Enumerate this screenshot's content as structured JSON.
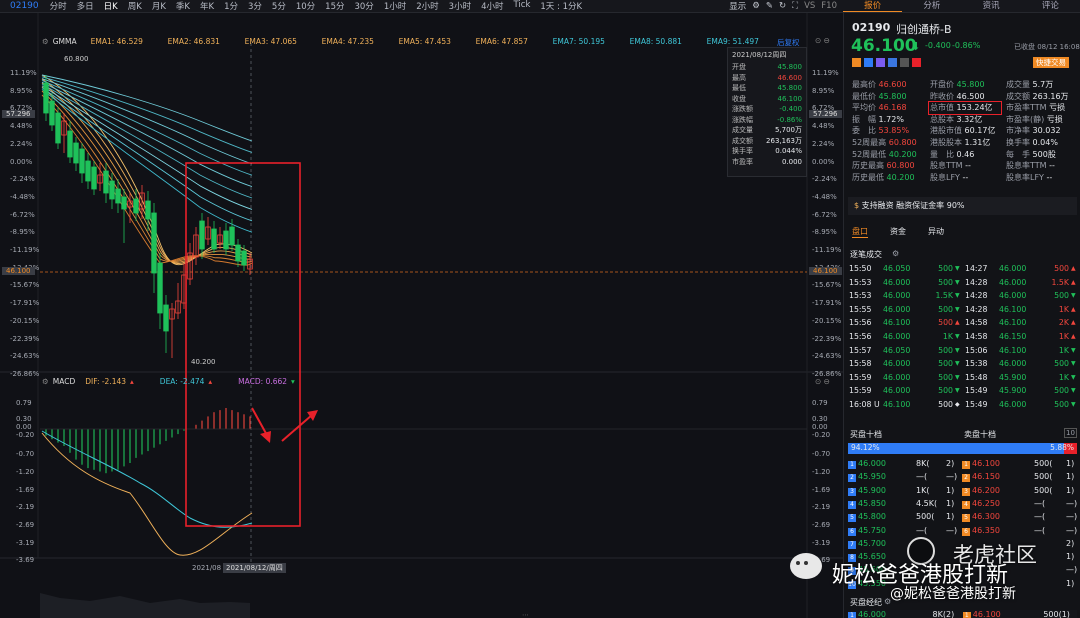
{
  "toolbar": {
    "code": "02190",
    "timeframes": [
      "分时",
      "多日",
      "日K",
      "周K",
      "月K",
      "季K",
      "年K",
      "1分",
      "3分",
      "5分",
      "10分",
      "15分",
      "30分",
      "1小时",
      "2小时",
      "3小时",
      "4小时",
      "Tick"
    ],
    "active_timeframe": "日K",
    "period_select": "1天 : 1分K",
    "display_label": "显示"
  },
  "right_tabs": [
    "报价",
    "分析",
    "资讯",
    "评论"
  ],
  "main_indicator": {
    "name": "GMMA",
    "emas": [
      {
        "label": "EMA1: 46.529",
        "color": "#f0b15a"
      },
      {
        "label": "EMA2: 46.831",
        "color": "#f0b15a"
      },
      {
        "label": "EMA3: 47.065",
        "color": "#f0b15a"
      },
      {
        "label": "EMA4: 47.235",
        "color": "#f0b15a"
      },
      {
        "label": "EMA5: 47.453",
        "color": "#f0b15a"
      },
      {
        "label": "EMA6: 47.857",
        "color": "#f0b15a"
      },
      {
        "label": "EMA7: 50.195",
        "color": "#3fc7d8"
      },
      {
        "label": "EMA8: 50.881",
        "color": "#3fc7d8"
      },
      {
        "label": "EMA9: 51.497",
        "color": "#3fc7d8"
      }
    ],
    "adjust_label": "后复权"
  },
  "y_axis_pct": [
    "11.19%",
    "8.95%",
    "6.72%",
    "4.48%",
    "2.24%",
    "0.00%",
    "-2.24%",
    "-4.48%",
    "-6.72%",
    "-8.95%",
    "-11.19%",
    "-13.43%",
    "-15.67%",
    "-17.91%",
    "-20.15%",
    "-22.39%",
    "-24.63%",
    "-26.86%"
  ],
  "price_tag_top": "57.296",
  "price_tag_current": "46.100",
  "high_marker": "60.800",
  "low_marker": "40.200",
  "info_box": {
    "date": "2021/08/12周四",
    "rows": [
      {
        "k": "开盘",
        "v": "45.800",
        "c": "grn"
      },
      {
        "k": "最高",
        "v": "46.600",
        "c": "red"
      },
      {
        "k": "最低",
        "v": "45.800",
        "c": "grn"
      },
      {
        "k": "收盘",
        "v": "46.100",
        "c": "grn"
      },
      {
        "k": "涨跌额",
        "v": "-0.400",
        "c": "grn"
      },
      {
        "k": "涨跌幅",
        "v": "-0.86%",
        "c": "grn"
      },
      {
        "k": "成交量",
        "v": "5,700万",
        "c": "wht"
      },
      {
        "k": "成交额",
        "v": "263,163万",
        "c": "wht"
      },
      {
        "k": "换手率",
        "v": "0.044%",
        "c": "wht"
      },
      {
        "k": "市盈率",
        "v": "0.000",
        "c": "wht"
      }
    ]
  },
  "macd": {
    "name": "MACD",
    "dif": "DIF: -2.143",
    "dea": "DEA: -2.474",
    "macd": "MACD: 0.662",
    "y_axis": [
      "0.79",
      "0.30",
      "0.00",
      "-0.20",
      "-0.70",
      "-1.20",
      "-1.69",
      "-2.19",
      "-2.69",
      "-3.19",
      "-3.69"
    ]
  },
  "x_axis": {
    "date1": "2021/08",
    "date2": "2021/08/12/周四"
  },
  "quote": {
    "code": "02190",
    "name": "归创通桥-B",
    "price": "46.100",
    "arrow": "⬇",
    "change": "-0.400",
    "change_pct": "-0.86%",
    "status": "已收盘 08/12 16:08",
    "quick_trade": "快捷交易",
    "fields": [
      [
        {
          "k": "最高价",
          "v": "46.600",
          "c": "red"
        },
        {
          "k": "开盘价",
          "v": "45.800",
          "c": "grn"
        },
        {
          "k": "成交量",
          "v": "5.7万",
          "c": "wht"
        }
      ],
      [
        {
          "k": "最低价",
          "v": "45.800",
          "c": "grn"
        },
        {
          "k": "昨收价",
          "v": "46.500",
          "c": "wht"
        },
        {
          "k": "成交额",
          "v": "263.16万",
          "c": "wht"
        }
      ],
      [
        {
          "k": "平均价",
          "v": "46.168",
          "c": "red"
        },
        {
          "k": "总市值",
          "v": "153.24亿",
          "c": "wht"
        },
        {
          "k": "市盈率TTM",
          "v": "亏损",
          "c": "wht"
        }
      ],
      [
        {
          "k": "振　幅",
          "v": "1.72%",
          "c": "wht"
        },
        {
          "k": "总股本",
          "v": "3.32亿",
          "c": "wht"
        },
        {
          "k": "市盈率(静)",
          "v": "亏损",
          "c": "wht"
        }
      ],
      [
        {
          "k": "委　比",
          "v": "53.85%",
          "c": "red"
        },
        {
          "k": "港股市值",
          "v": "60.17亿",
          "c": "wht"
        },
        {
          "k": "市净率",
          "v": "30.032",
          "c": "wht"
        }
      ],
      [
        {
          "k": "52周最高",
          "v": "60.800",
          "c": "red"
        },
        {
          "k": "港股股本",
          "v": "1.31亿",
          "c": "wht"
        },
        {
          "k": "换手率",
          "v": "0.04%",
          "c": "wht"
        }
      ],
      [
        {
          "k": "52周最低",
          "v": "40.200",
          "c": "grn"
        },
        {
          "k": "量　比",
          "v": "0.46",
          "c": "wht"
        },
        {
          "k": "每　手",
          "v": "500股",
          "c": "wht"
        }
      ],
      [
        {
          "k": "历史最高",
          "v": "60.800",
          "c": "red"
        },
        {
          "k": "股息TTM",
          "v": "--",
          "c": "wht"
        },
        {
          "k": "股息率TTM",
          "v": "--",
          "c": "wht"
        }
      ],
      [
        {
          "k": "历史最低",
          "v": "40.200",
          "c": "grn"
        },
        {
          "k": "股息LFY",
          "v": "--",
          "c": "wht"
        },
        {
          "k": "股息率LFY",
          "v": "--",
          "c": "wht"
        }
      ]
    ],
    "margin_text": "支持融资 融资保证金率 90%",
    "sub_tabs": [
      "盘口",
      "资金",
      "异动"
    ],
    "ticks_title": "逐笔成交",
    "ticks_left": [
      {
        "t": "15:50",
        "p": "46.050",
        "v": "500",
        "d": "down"
      },
      {
        "t": "15:53",
        "p": "46.000",
        "v": "500",
        "d": "down"
      },
      {
        "t": "15:53",
        "p": "46.000",
        "v": "1.5K",
        "d": "down"
      },
      {
        "t": "15:55",
        "p": "46.000",
        "v": "500",
        "d": "down"
      },
      {
        "t": "15:56",
        "p": "46.100",
        "v": "500",
        "d": "up"
      },
      {
        "t": "15:56",
        "p": "46.000",
        "v": "1K",
        "d": "down"
      },
      {
        "t": "15:57",
        "p": "46.050",
        "v": "500",
        "d": "down"
      },
      {
        "t": "15:58",
        "p": "46.000",
        "v": "500",
        "d": "down"
      },
      {
        "t": "15:59",
        "p": "46.000",
        "v": "500",
        "d": "down"
      },
      {
        "t": "15:59",
        "p": "46.000",
        "v": "500",
        "d": "down"
      },
      {
        "t": "16:08 U",
        "p": "46.100",
        "v": "500",
        "d": "neutral"
      }
    ],
    "ticks_right": [
      {
        "t": "14:27",
        "p": "46.000",
        "v": "500",
        "d": "up"
      },
      {
        "t": "14:28",
        "p": "46.000",
        "v": "1.5K",
        "d": "up"
      },
      {
        "t": "14:28",
        "p": "46.000",
        "v": "500",
        "d": "down"
      },
      {
        "t": "14:28",
        "p": "46.100",
        "v": "1K",
        "d": "up"
      },
      {
        "t": "14:58",
        "p": "46.100",
        "v": "2K",
        "d": "up"
      },
      {
        "t": "14:58",
        "p": "46.150",
        "v": "1K",
        "d": "up"
      },
      {
        "t": "15:06",
        "p": "46.100",
        "v": "1K",
        "d": "down"
      },
      {
        "t": "15:38",
        "p": "46.000",
        "v": "500",
        "d": "down"
      },
      {
        "t": "15:48",
        "p": "45.900",
        "v": "1K",
        "d": "down"
      },
      {
        "t": "15:49",
        "p": "45.900",
        "v": "500",
        "d": "down"
      },
      {
        "t": "15:49",
        "p": "46.000",
        "v": "500",
        "d": "down"
      }
    ],
    "book_title_bid": "买盘十档",
    "book_title_ask": "卖盘十档",
    "bid_pct": "94.12%",
    "ask_pct": "5.88%",
    "bids": [
      {
        "n": "1",
        "p": "46.000",
        "v": "8K(",
        "c": "2)"
      },
      {
        "n": "2",
        "p": "45.950",
        "v": "—(",
        "c": "—)"
      },
      {
        "n": "3",
        "p": "45.900",
        "v": "1K(",
        "c": "1)"
      },
      {
        "n": "4",
        "p": "45.850",
        "v": "4.5K(",
        "c": "1)"
      },
      {
        "n": "5",
        "p": "45.800",
        "v": "500(",
        "c": "1)"
      },
      {
        "n": "6",
        "p": "45.750",
        "v": "—(",
        "c": "—)"
      },
      {
        "n": "7",
        "p": "45.700",
        "v": "",
        "c": ""
      },
      {
        "n": "8",
        "p": "45.650",
        "v": "",
        "c": ""
      },
      {
        "n": "9",
        "p": "45.600",
        "v": "",
        "c": ""
      },
      {
        "n": "10",
        "p": "45.550",
        "v": "",
        "c": ""
      }
    ],
    "asks": [
      {
        "n": "1",
        "p": "46.100",
        "v": "500(",
        "c": "1)"
      },
      {
        "n": "2",
        "p": "46.150",
        "v": "500(",
        "c": "1)"
      },
      {
        "n": "3",
        "p": "46.200",
        "v": "500(",
        "c": "1)"
      },
      {
        "n": "4",
        "p": "46.250",
        "v": "—(",
        "c": "—)"
      },
      {
        "n": "5",
        "p": "46.300",
        "v": "—(",
        "c": "—)"
      },
      {
        "n": "6",
        "p": "46.350",
        "v": "—(",
        "c": "—)"
      },
      {
        "n": "7",
        "p": "",
        "v": "",
        "c": "2)"
      },
      {
        "n": "8",
        "p": "",
        "v": "",
        "c": "1)"
      },
      {
        "n": "9",
        "p": "",
        "v": "",
        "c": "—)"
      },
      {
        "n": "10",
        "p": "",
        "v": "",
        "c": "1)"
      }
    ],
    "brokers_title": "买盘经纪",
    "bottom_row": {
      "p": "46.000",
      "v": "8K(2)",
      "p2": "46.100",
      "v2": "500(1)"
    }
  },
  "watermark": {
    "line1": "老虎社区",
    "line2": "妮松爸爸港股打新",
    "line3": "@妮松爸爸港股打新"
  },
  "colors": {
    "up": "#f2463d",
    "down": "#1fc15a",
    "accent": "#2f7cf6",
    "orange": "#f08a24",
    "highlight_box": "#e8212a"
  }
}
